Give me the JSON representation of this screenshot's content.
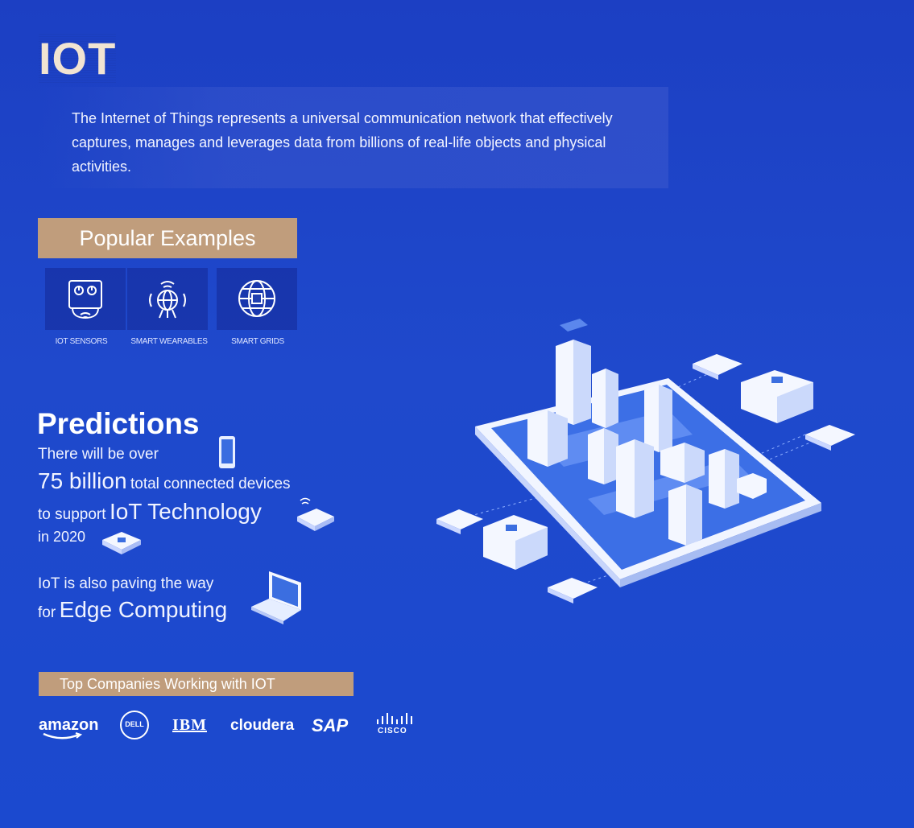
{
  "header": {
    "title": "IOT",
    "intro": "The Internet of Things represents a universal communication network that effectively captures, manages and leverages data from billions of real-life objects and physical activities."
  },
  "popular": {
    "heading": "Popular Examples",
    "items": [
      {
        "label": "IOT SENSORS",
        "icon": "tablet-sensor-icon"
      },
      {
        "label": "SMART WEARABLES",
        "icon": "wireless-globe-icon"
      },
      {
        "label": "SMART GRIDS",
        "icon": "globe-chip-icon"
      }
    ]
  },
  "predictions": {
    "heading": "Predictions",
    "line1": "There will be over",
    "line2_big": "75 billion",
    "line2_rest": "total connected devices",
    "line3_small": "to support",
    "line3_big": "IoT Technology",
    "line4": "in 2020",
    "line5": "IoT is also paving the way",
    "line6_small": "for",
    "line6_big": "Edge Computing"
  },
  "companies": {
    "heading": "Top Companies Working with IOT",
    "logos": [
      "amazon",
      "DELL",
      "IBM",
      "cloudera",
      "SAP",
      "CISCO"
    ]
  },
  "colors": {
    "background": "#1c45c9",
    "banner": "#c09d7c",
    "title": "#f1e4d2"
  }
}
